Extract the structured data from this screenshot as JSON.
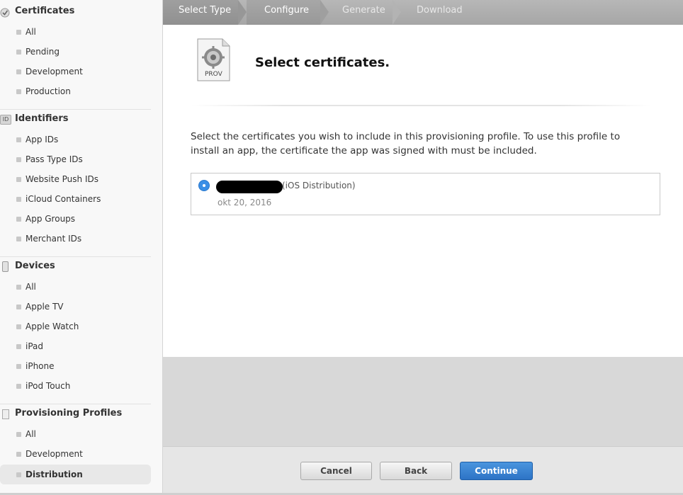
{
  "sidebar": {
    "sections": [
      {
        "title": "Certificates",
        "icon": "certificate-icon",
        "items": [
          "All",
          "Pending",
          "Development",
          "Production"
        ]
      },
      {
        "title": "Identifiers",
        "icon": "id-icon",
        "icon_text": "ID",
        "items": [
          "App IDs",
          "Pass Type IDs",
          "Website Push IDs",
          "iCloud Containers",
          "App Groups",
          "Merchant IDs"
        ]
      },
      {
        "title": "Devices",
        "icon": "device-icon",
        "items": [
          "All",
          "Apple TV",
          "Apple Watch",
          "iPad",
          "iPhone",
          "iPod Touch"
        ]
      },
      {
        "title": "Provisioning Profiles",
        "icon": "document-icon",
        "items": [
          "All",
          "Development",
          "Distribution"
        ],
        "active_item": "Distribution"
      }
    ]
  },
  "steps": [
    {
      "label": "Select Type",
      "state": "done"
    },
    {
      "label": "Configure",
      "state": "current"
    },
    {
      "label": "Generate",
      "state": "todo"
    },
    {
      "label": "Download",
      "state": "todo"
    }
  ],
  "main": {
    "icon_label": "PROV",
    "heading": "Select certificates.",
    "description": "Select the certificates you wish to include in this provisioning profile. To use this profile to install an app, the certificate the app was signed with must be included.",
    "certificate": {
      "type": "(iOS Distribution)",
      "date": "okt 20, 2016",
      "selected": true
    }
  },
  "footer": {
    "cancel_label": "Cancel",
    "back_label": "Back",
    "continue_label": "Continue"
  },
  "colors": {
    "accent": "#2d73c6",
    "radio": "#3b8fe6",
    "sidebar_bg": "#f8f8f8",
    "steps_bg": "#a9a9a9"
  }
}
